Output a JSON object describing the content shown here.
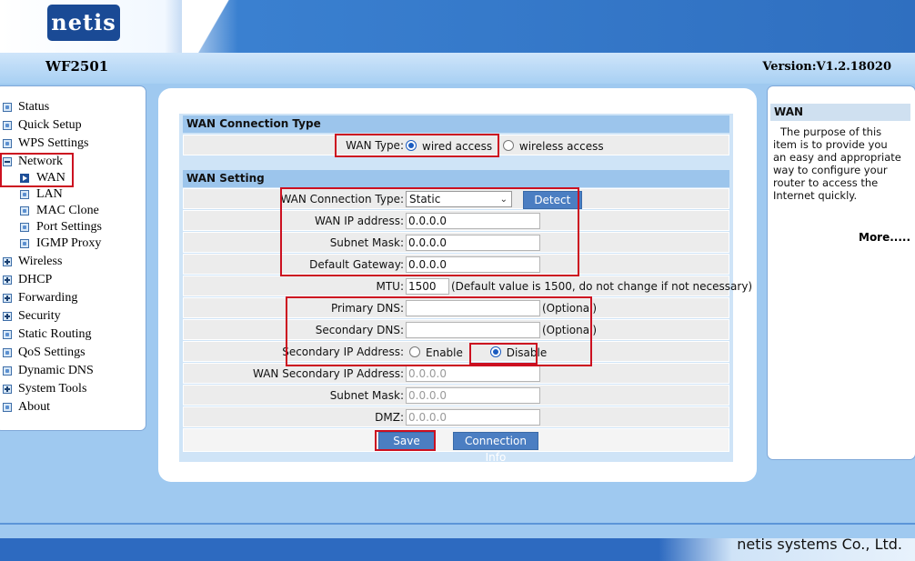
{
  "header": {
    "logo_text": "netis",
    "model": "WF2501",
    "version": "Version:V1.2.18020"
  },
  "sidebar": {
    "items": [
      {
        "label": "Status",
        "icon": "dot-icon"
      },
      {
        "label": "Quick Setup",
        "icon": "dot-icon"
      },
      {
        "label": "WPS Settings",
        "icon": "dot-icon"
      },
      {
        "label": "Network",
        "icon": "minus-icon"
      },
      {
        "label": "WAN",
        "icon": "arrow-icon",
        "sub": true
      },
      {
        "label": "LAN",
        "icon": "dot-icon",
        "sub": true
      },
      {
        "label": "MAC Clone",
        "icon": "dot-icon",
        "sub": true
      },
      {
        "label": "Port Settings",
        "icon": "dot-icon",
        "sub": true
      },
      {
        "label": "IGMP Proxy",
        "icon": "dot-icon",
        "sub": true
      },
      {
        "label": "Wireless",
        "icon": "plus-icon"
      },
      {
        "label": "DHCP",
        "icon": "plus-icon"
      },
      {
        "label": "Forwarding",
        "icon": "plus-icon"
      },
      {
        "label": "Security",
        "icon": "plus-icon"
      },
      {
        "label": "Static Routing",
        "icon": "dot-icon"
      },
      {
        "label": "QoS Settings",
        "icon": "dot-icon"
      },
      {
        "label": "Dynamic DNS",
        "icon": "dot-icon"
      },
      {
        "label": "System Tools",
        "icon": "plus-icon"
      },
      {
        "label": "About",
        "icon": "dot-icon"
      }
    ]
  },
  "wan_type": {
    "section_title": "WAN Connection Type",
    "label": "WAN Type:",
    "options": [
      "wired access",
      "wireless access"
    ],
    "selected": "wired access"
  },
  "wan_setting": {
    "section_title": "WAN Setting",
    "connection_type_label": "WAN Connection Type:",
    "connection_type_value": "Static",
    "detect_button": "Detect",
    "wan_ip_label": "WAN IP address:",
    "wan_ip_value": "0.0.0.0",
    "subnet_label": "Subnet Mask:",
    "subnet_value": "0.0.0.0",
    "gateway_label": "Default Gateway:",
    "gateway_value": "0.0.0.0",
    "mtu_label": "MTU:",
    "mtu_value": "1500",
    "mtu_note": "(Default value is 1500, do not change if not necessary)",
    "primary_dns_label": "Primary DNS:",
    "primary_dns_value": "",
    "secondary_dns_label": "Secondary DNS:",
    "secondary_dns_value": "",
    "optional_note": "(Optional)",
    "secondary_ip_label": "Secondary IP Address:",
    "secondary_ip_options": [
      "Enable",
      "Disable"
    ],
    "secondary_ip_selected": "Disable",
    "wan_secondary_ip_label": "WAN Secondary IP Address:",
    "wan_secondary_ip_value": "0.0.0.0",
    "subnet2_label": "Subnet Mask:",
    "subnet2_value": "0.0.0.0",
    "dmz_label": "DMZ:",
    "dmz_value": "0.0.0.0",
    "save_button": "Save",
    "connection_info_button": "Connection Info"
  },
  "help": {
    "title": "WAN",
    "text": "The purpose of this item is to provide you an easy and appropriate way to configure your router to access the Internet quickly.",
    "more": "More....."
  },
  "footer": {
    "copyright": "netis systems Co., Ltd."
  },
  "colors": {
    "accent_blue": "#2f6fc0",
    "highlight_red": "#cc1020",
    "button_blue": "#4b7ec2"
  }
}
